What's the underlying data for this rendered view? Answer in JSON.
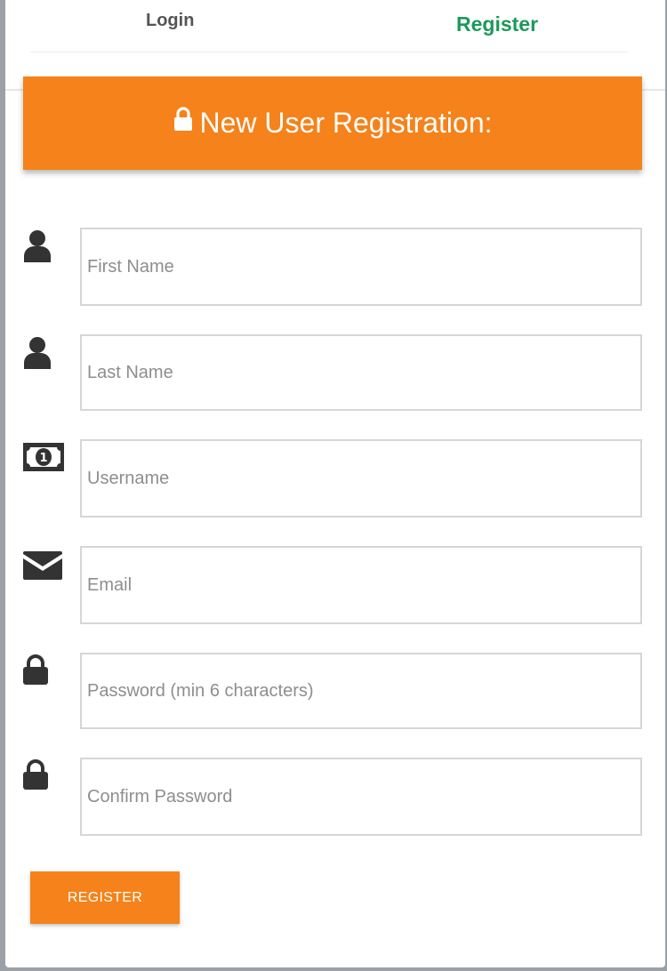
{
  "tabs": {
    "login_label": "Login",
    "register_label": "Register"
  },
  "banner": {
    "icon": "lock-icon",
    "title": "New User Registration:"
  },
  "fields": {
    "first_name": {
      "placeholder": "First Name",
      "icon": "user-icon"
    },
    "last_name": {
      "placeholder": "Last Name",
      "icon": "user-icon"
    },
    "username": {
      "placeholder": "Username",
      "icon": "money-bill-icon"
    },
    "email": {
      "placeholder": "Email",
      "icon": "envelope-icon"
    },
    "password": {
      "placeholder": "Password (min 6 characters)",
      "icon": "lock-icon"
    },
    "confirm_password": {
      "placeholder": "Confirm Password",
      "icon": "lock-icon"
    }
  },
  "submit": {
    "label": "REGISTER"
  },
  "colors": {
    "accent": "#f5821a",
    "active_tab": "#1a9a5a",
    "inactive_tab": "#555555",
    "icon": "#333333"
  }
}
